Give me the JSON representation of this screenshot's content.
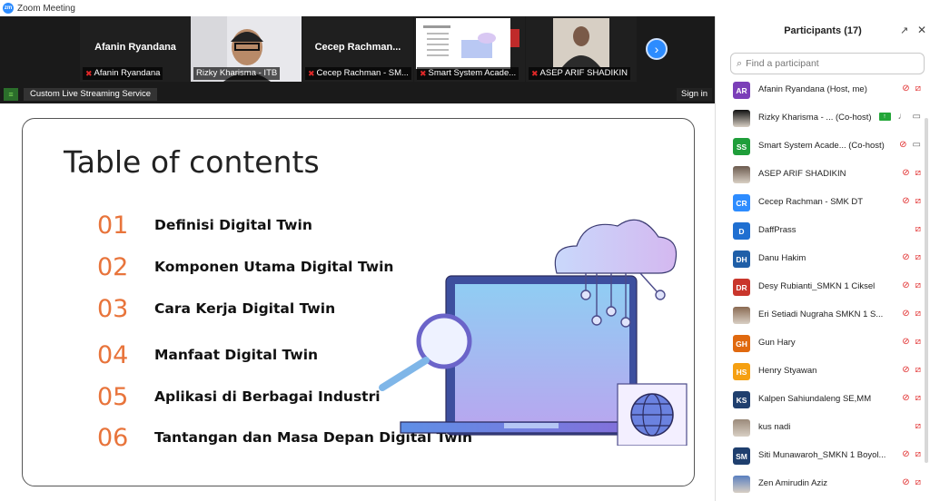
{
  "window": {
    "title": "Zoom Meeting",
    "logo": "zm"
  },
  "strip": {
    "tiles": [
      {
        "bigname": "Afanin Ryandana",
        "label": "Afanin Ryandana"
      },
      {
        "bigname": "",
        "label": "Rizky Kharisma - ITB"
      },
      {
        "bigname": "Cecep Rachman...",
        "label": "Cecep Rachman - SM..."
      },
      {
        "bigname": "",
        "label": "Smart System Acade..."
      },
      {
        "bigname": "",
        "label": "ASEP ARIF SHADIKIN"
      }
    ],
    "next_icon": "chevron-right-icon"
  },
  "infobar": {
    "stream_label": "Custom Live Streaming Service",
    "signin": "Sign in"
  },
  "slide": {
    "title": "Table of contents",
    "items": [
      {
        "num": "01",
        "text": "Definisi Digital Twin"
      },
      {
        "num": "02",
        "text": "Komponen Utama Digital Twin"
      },
      {
        "num": "03",
        "text": "Cara Kerja Digital Twin"
      },
      {
        "num": "04",
        "text": "Manfaat Digital Twin"
      },
      {
        "num": "05",
        "text": "Aplikasi di Berbagai Industri"
      },
      {
        "num": "06",
        "text": "Tantangan dan Masa Depan Digital Twin"
      }
    ]
  },
  "panel": {
    "title": "Participants (17)",
    "search_placeholder": "Find a participant",
    "participants": [
      {
        "initials": "AR",
        "color": "#7b3fb8",
        "name": "Afanin Ryandana (Host, me)",
        "mic": "off",
        "cam": "off",
        "photo": false
      },
      {
        "initials": "",
        "color": "#111111",
        "name": "Rizky Kharisma - ...  (Co-host)",
        "mic": "on",
        "cam": "on",
        "photo": true,
        "share": true
      },
      {
        "initials": "SS",
        "color": "#1f9e3a",
        "name": "Smart System Acade...  (Co-host)",
        "mic": "off",
        "cam": "on",
        "photo": false
      },
      {
        "initials": "",
        "color": "#6b5a4e",
        "name": "ASEP ARIF SHADIKIN",
        "mic": "off",
        "cam": "off",
        "photo": true
      },
      {
        "initials": "CR",
        "color": "#2d8cff",
        "name": "Cecep Rachman - SMK DT",
        "mic": "off",
        "cam": "off",
        "photo": false
      },
      {
        "initials": "D",
        "color": "#1f6fd1",
        "name": "DaffPrass",
        "mic": "none",
        "cam": "off",
        "photo": false
      },
      {
        "initials": "DH",
        "color": "#1f5fa8",
        "name": "Danu Hakim",
        "mic": "off",
        "cam": "off",
        "photo": false
      },
      {
        "initials": "DR",
        "color": "#c9362c",
        "name": "Desy Rubianti_SMKN 1 Ciksel",
        "mic": "off",
        "cam": "off",
        "photo": false
      },
      {
        "initials": "",
        "color": "#8a6a52",
        "name": "Eri Setiadi Nugraha SMKN 1 S...",
        "mic": "off",
        "cam": "off",
        "photo": true
      },
      {
        "initials": "GH",
        "color": "#e0690f",
        "name": "Gun Hary",
        "mic": "off",
        "cam": "off",
        "photo": false
      },
      {
        "initials": "HS",
        "color": "#f5a012",
        "name": "Henry Styawan",
        "mic": "off",
        "cam": "off",
        "photo": false
      },
      {
        "initials": "KS",
        "color": "#1f3f6e",
        "name": "Kalpen Sahiundaleng SE,MM",
        "mic": "off",
        "cam": "off",
        "photo": false
      },
      {
        "initials": "",
        "color": "#9b8a7a",
        "name": "kus nadi",
        "mic": "none",
        "cam": "off",
        "photo": true
      },
      {
        "initials": "SM",
        "color": "#1f3f6e",
        "name": "Siti Munawaroh_SMKN 1 Boyol...",
        "mic": "off",
        "cam": "off",
        "photo": false
      },
      {
        "initials": "",
        "color": "#5a7fbf",
        "name": "Zen Amirudin Aziz",
        "mic": "off",
        "cam": "off",
        "photo": true
      }
    ]
  }
}
